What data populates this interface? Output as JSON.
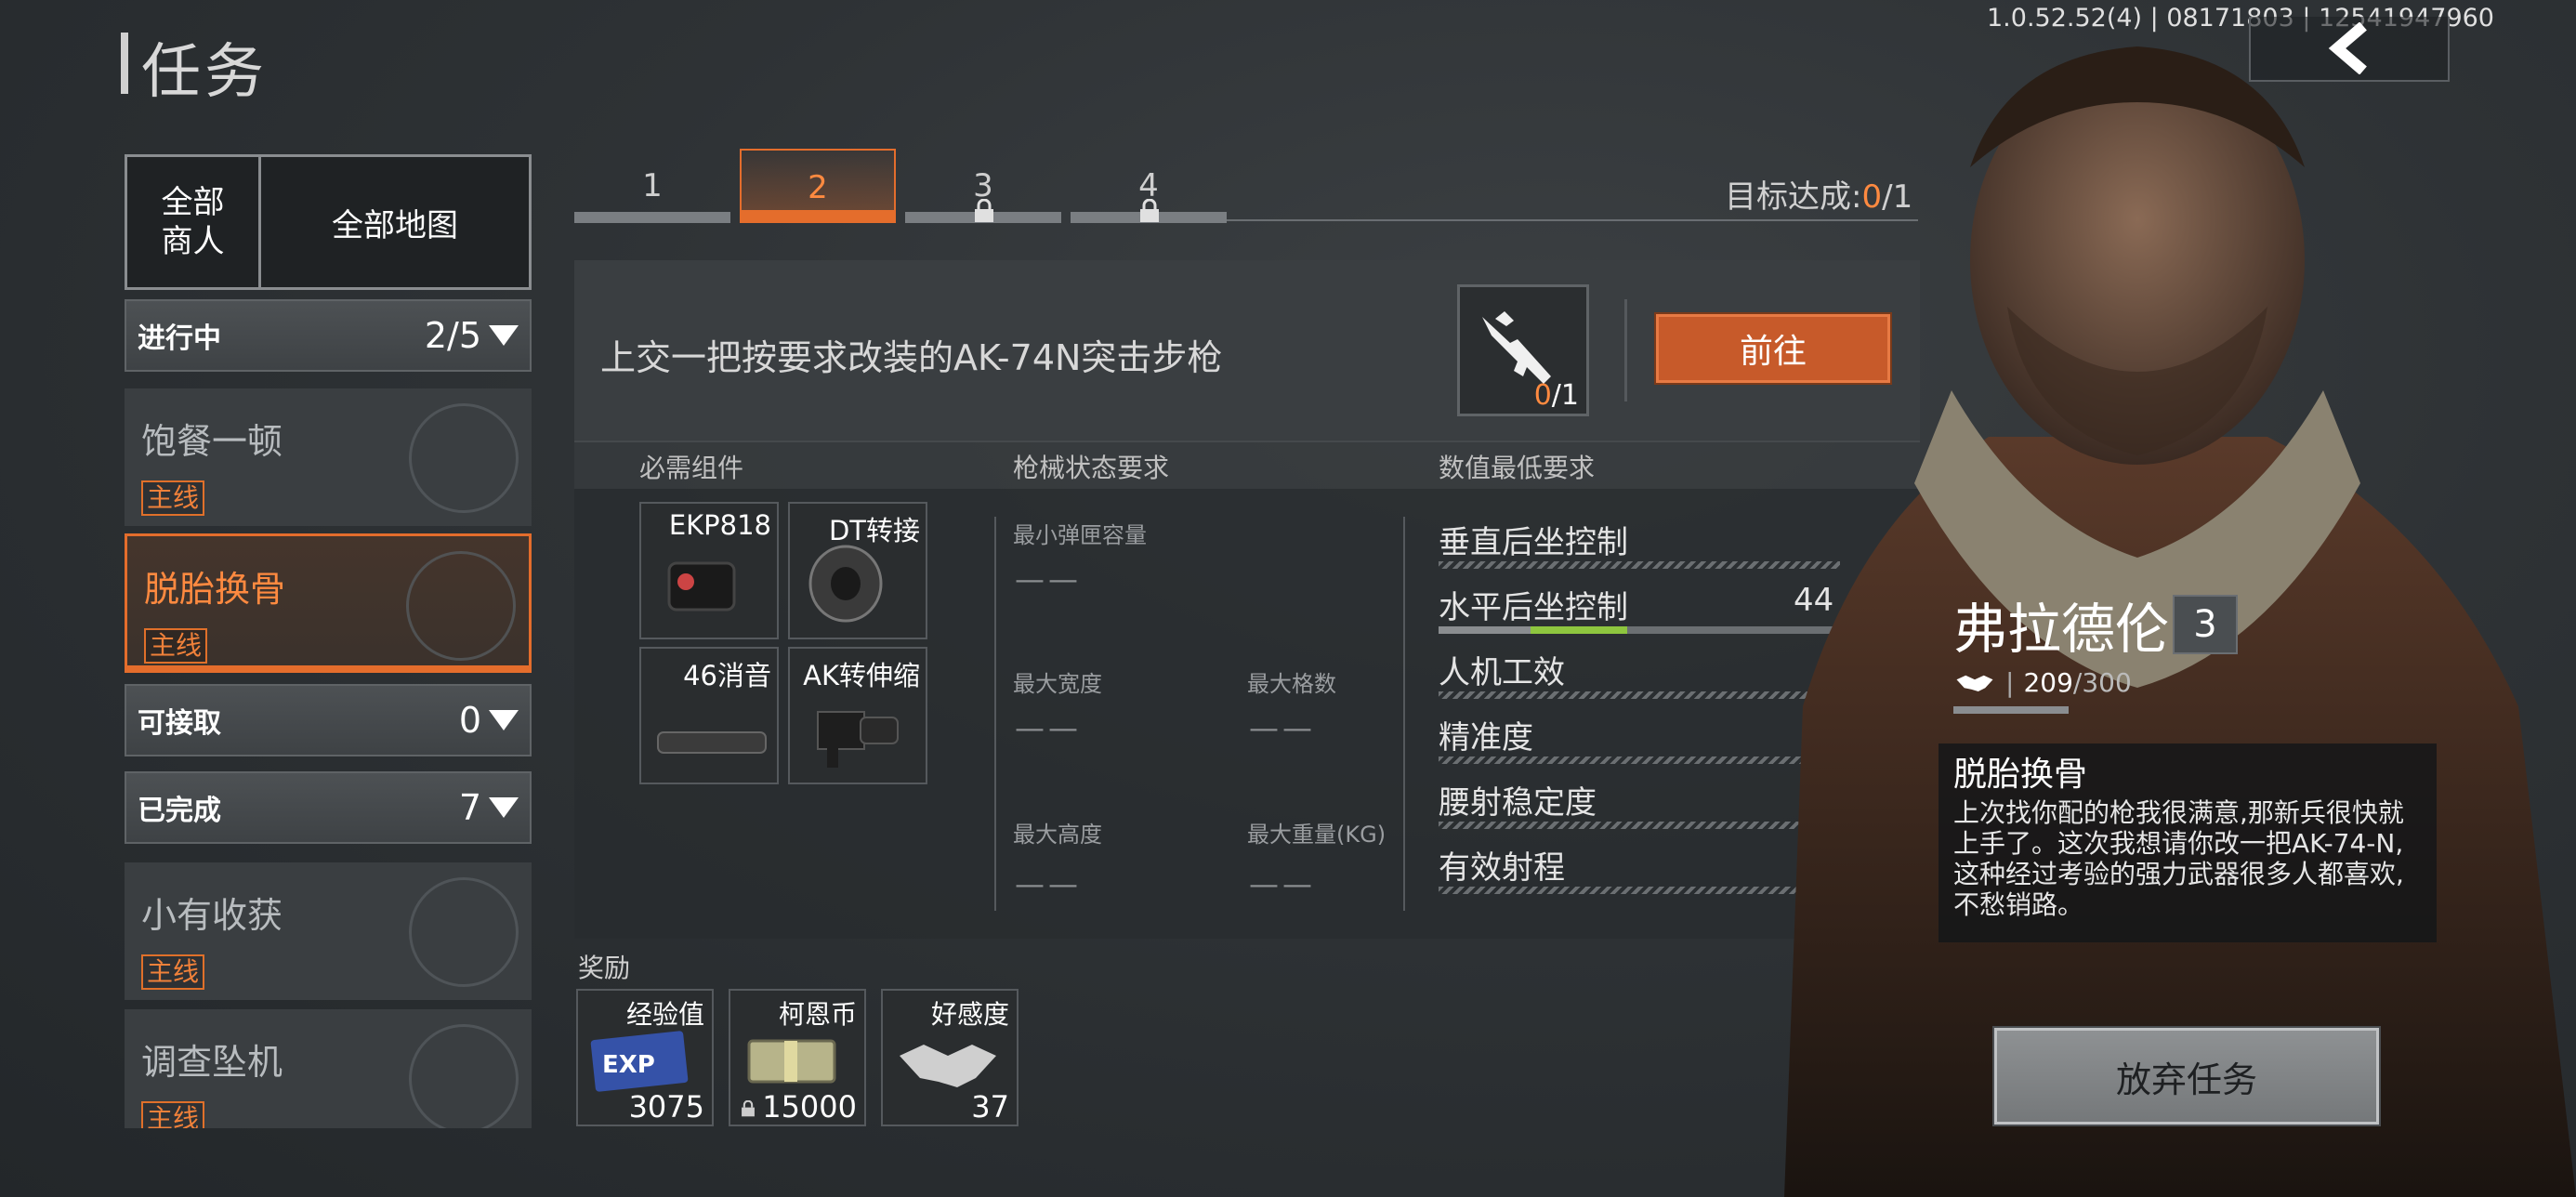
{
  "header": {
    "title": "任务",
    "version": "1.0.52.52(4) | 08171803 | 12541947960",
    "back_icon": "chevron-left-icon"
  },
  "sidebar": {
    "filter": {
      "merchant": "全部\n商人",
      "map": "全部地图"
    },
    "in_progress": {
      "label": "进行中",
      "count": "2/5"
    },
    "available": {
      "label": "可接取",
      "count": "0"
    },
    "completed": {
      "label": "已完成",
      "count": "7"
    },
    "tasks_in_progress": [
      {
        "name": "饱餐一顿",
        "tag": "主线"
      },
      {
        "name": "脱胎换骨",
        "tag": "主线",
        "active": true
      }
    ],
    "tasks_completed": [
      {
        "name": "小有收获",
        "tag": "主线"
      },
      {
        "name": "调查坠机",
        "tag": "主线"
      }
    ]
  },
  "tabs": [
    {
      "label": "1",
      "locked": false
    },
    {
      "label": "2",
      "locked": false,
      "active": true
    },
    {
      "label": "3",
      "locked": true
    },
    {
      "label": "4",
      "locked": true
    }
  ],
  "goal": {
    "label": "目标达成:",
    "done": "0",
    "total": "/1"
  },
  "objective": {
    "text": "上交一把按要求改装的AK-74N突击步枪",
    "count_done": "0",
    "count_total": "/1",
    "go_label": "前往"
  },
  "columns": {
    "parts": "必需组件",
    "state": "枪械状态要求",
    "min": "数值最低要求"
  },
  "parts": [
    {
      "label": "EKP818",
      "icon": "red-dot-sight-icon"
    },
    {
      "label": "DT转接",
      "icon": "muzzle-adapter-icon"
    },
    {
      "label": "46消音",
      "icon": "suppressor-icon"
    },
    {
      "label": "AK转伸缩",
      "icon": "stock-adapter-icon"
    }
  ],
  "state_reqs": {
    "mag": {
      "label": "最小弹匣容量",
      "value": "——"
    },
    "width": {
      "label": "最大宽度",
      "value": "——"
    },
    "grid": {
      "label": "最大格数",
      "value": "——"
    },
    "height": {
      "label": "最大高度",
      "value": "——"
    },
    "weight": {
      "label": "最大重量(KG)",
      "value": "——"
    }
  },
  "min_reqs": [
    {
      "label": "垂直后坐控制"
    },
    {
      "label": "水平后坐控制",
      "value": "44"
    },
    {
      "label": "人机工效"
    },
    {
      "label": "精准度"
    },
    {
      "label": "腰射稳定度"
    },
    {
      "label": "有效射程"
    }
  ],
  "rewards": {
    "label": "奖励",
    "items": [
      {
        "label": "经验值",
        "value": "3075",
        "icon": "exp-ticket-icon"
      },
      {
        "label": "柯恩币",
        "value": "15000",
        "icon": "cash-stack-icon"
      },
      {
        "label": "好感度",
        "value": "37",
        "icon": "handshake-icon"
      }
    ]
  },
  "npc": {
    "name": "弗拉德伦",
    "level": "3",
    "favor": "209",
    "favor_max": "/300",
    "quest_title": "脱胎换骨",
    "dialogue": "上次找你配的枪我很满意,那新兵很快就上手了。这次我想请你改一把AK-74-N,这种经过考验的强力武器很多人都喜欢,不愁销路。",
    "abandon_label": "放弃任务"
  },
  "colors": {
    "accent": "#e46d2c",
    "accent_text": "#ff8a40",
    "panel": "#3a3e41",
    "background": "#2e3235"
  }
}
